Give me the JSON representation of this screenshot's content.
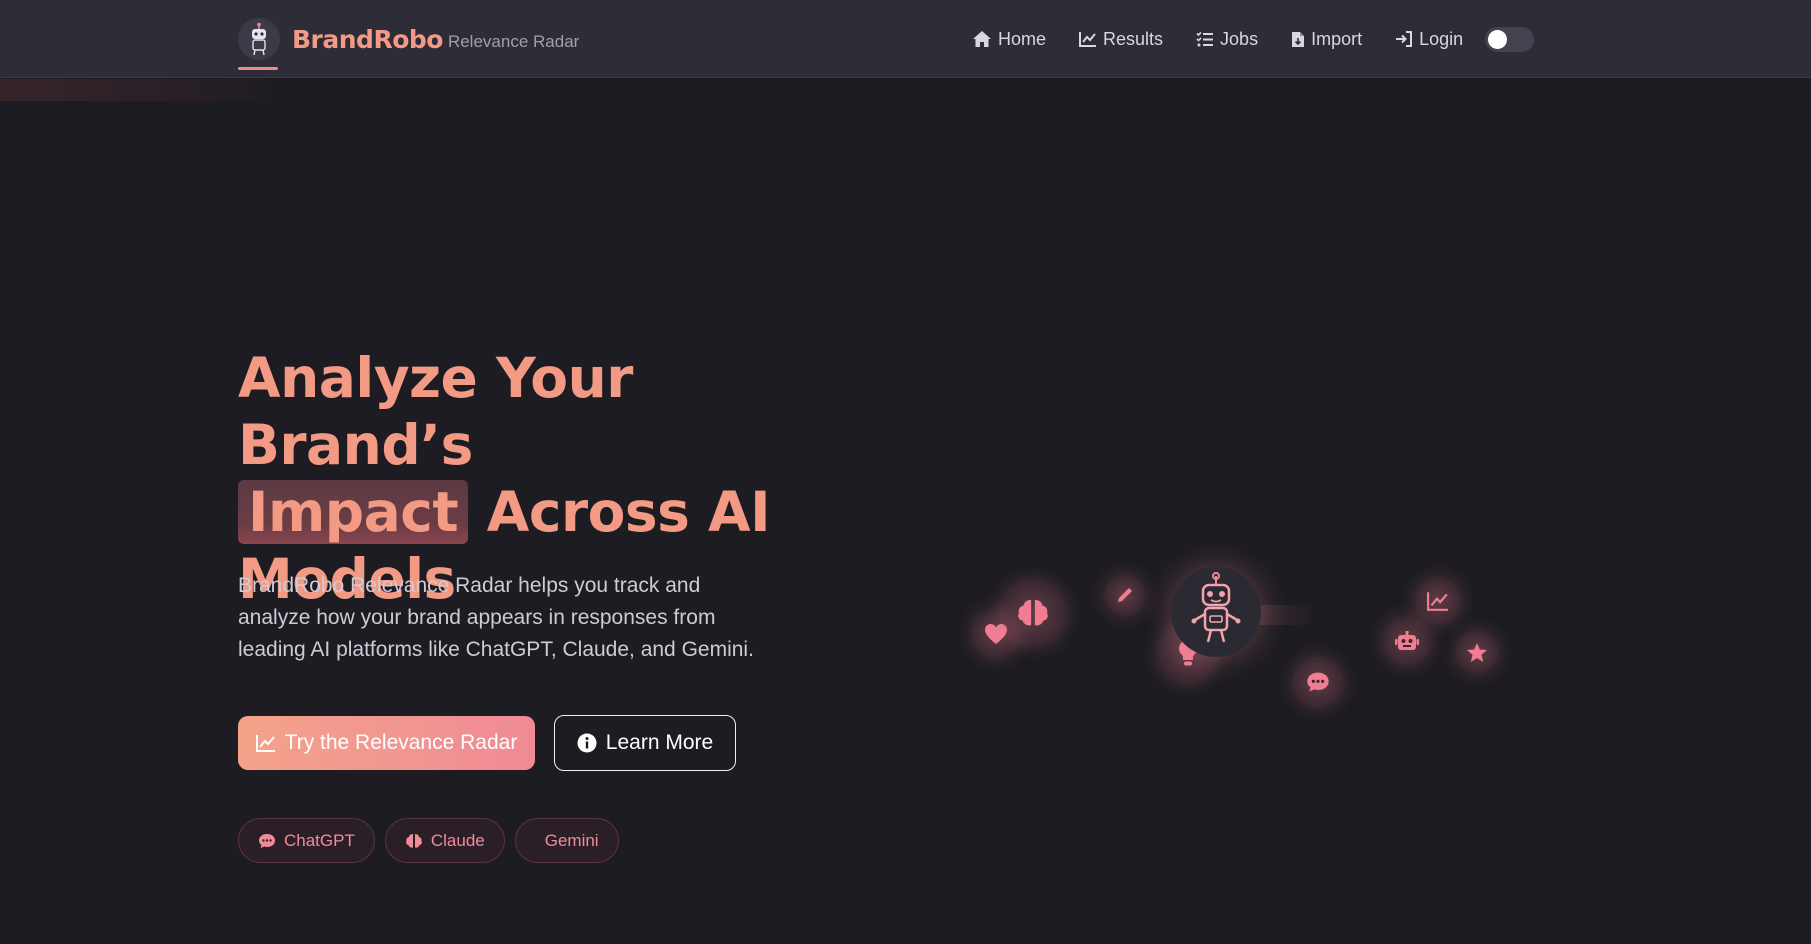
{
  "brand": {
    "name": "BrandRobo",
    "subtitle": "Relevance Radar",
    "logo_icon": "robot-icon"
  },
  "nav": {
    "items": [
      {
        "label": "Home",
        "icon": "home-icon"
      },
      {
        "label": "Results",
        "icon": "chart-line-icon"
      },
      {
        "label": "Jobs",
        "icon": "list-check-icon"
      },
      {
        "label": "Import",
        "icon": "file-import-icon"
      },
      {
        "label": "Login",
        "icon": "sign-in-icon"
      }
    ],
    "theme_toggle": {
      "state": "off"
    }
  },
  "hero": {
    "title_line1": "Analyze Your Brand’s",
    "title_highlight": "Impact",
    "title_line2_rest": " Across AI",
    "title_line3": "Models",
    "description": "BrandRobo Relevance Radar helps you track and analyze how your brand appears in responses from leading AI platforms like ChatGPT, Claude, and Gemini.",
    "primary_button": "Try the Relevance Radar",
    "secondary_button": "Learn More",
    "platforms": [
      {
        "label": "ChatGPT",
        "icon": "comment-dots-icon"
      },
      {
        "label": "Claude",
        "icon": "brain-icon"
      },
      {
        "label": "Gemini",
        "icon": ""
      }
    ]
  },
  "illustration": {
    "icons": [
      "heart-icon",
      "brain-icon",
      "pen-icon",
      "robot-icon",
      "lightbulb-icon",
      "comment-dots-icon",
      "chart-line-icon",
      "robot-icon",
      "star-icon"
    ]
  },
  "colors": {
    "accent": "#f39a84",
    "accent_pink": "#f08a95",
    "background": "#1d1c22",
    "navbar": "#2d2c37"
  }
}
